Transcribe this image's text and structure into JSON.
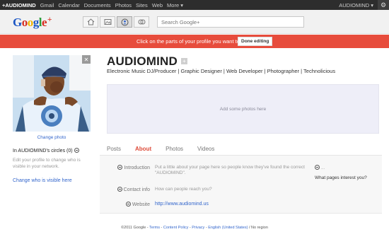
{
  "topbar": {
    "brand": "+AUDIOMIND",
    "links": [
      "Gmail",
      "Calendar",
      "Documents",
      "Photos",
      "Sites",
      "Web",
      "More ▾"
    ],
    "user": "AUDIOMIND ▾",
    "gear_icon": "gear-icon"
  },
  "header": {
    "search_placeholder": "Search Google+",
    "toolbar": [
      "home-icon",
      "photos-icon",
      "profile-icon",
      "circles-icon"
    ]
  },
  "banner": {
    "message": "Click on the parts of your profile you want to edit.",
    "done_label": "Done editing",
    "color": "#e74c3c"
  },
  "sidebar": {
    "change_photo": "Change photo",
    "circles": "In AUDIOMIND's circles (0)",
    "edit_hint": "Edit your profile to change who is visible in your network.",
    "change_visible": "Change who is visible here"
  },
  "profile": {
    "name": "AUDIOMIND",
    "tagline": "Electronic Music DJ/Producer | Graphic Designer | Web Developer | Photographer | Technolicious",
    "photos_placeholder": "Add some photos here"
  },
  "tabs": [
    {
      "label": "Posts"
    },
    {
      "label": "About",
      "active": true
    },
    {
      "label": "Photos"
    },
    {
      "label": "Videos"
    }
  ],
  "about": {
    "introduction_label": "Introduction",
    "introduction_value": "Put a little about your page here so people know they've found the correct \"AUDIOMIND\".",
    "contact_label": "Contact info",
    "contact_value": "How can people reach you?",
    "website_label": "Website",
    "website_value": "http://www.audiomind.us",
    "side_q": "...",
    "side_pages": "What pages interest you?"
  },
  "footer": {
    "copyright": "©2011 Google - ",
    "links": [
      "Terms",
      "Content Policy",
      "Privacy",
      "English (United States)"
    ],
    "no_region": " / No region"
  }
}
